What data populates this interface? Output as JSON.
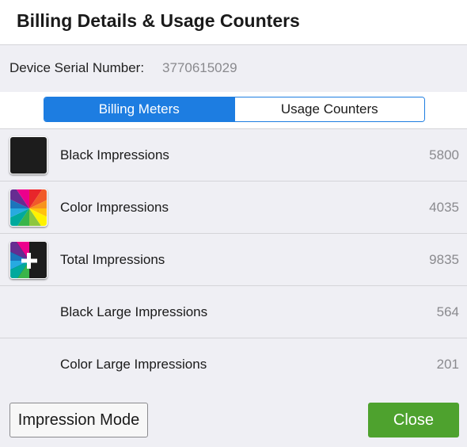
{
  "dialog": {
    "title": "Billing Details & Usage Counters"
  },
  "device": {
    "serial_label": "Device Serial Number:",
    "serial_value": "3770615029"
  },
  "tabs": [
    {
      "label": "Billing Meters",
      "active": true
    },
    {
      "label": "Usage Counters",
      "active": false
    }
  ],
  "meters": [
    {
      "label": "Black Impressions",
      "value": "5800",
      "icon": "black-swatch-icon"
    },
    {
      "label": "Color Impressions",
      "value": "4035",
      "icon": "color-wheel-icon"
    },
    {
      "label": "Total Impressions",
      "value": "9835",
      "icon": "total-plus-icon"
    },
    {
      "label": "Black Large Impressions",
      "value": "564",
      "icon": ""
    },
    {
      "label": "Color Large Impressions",
      "value": "201",
      "icon": ""
    }
  ],
  "footer": {
    "mode_button": "Impression Mode",
    "close_button": "Close"
  },
  "colors": {
    "accent_blue": "#1d7de1",
    "close_green": "#4ea22e",
    "list_background": "#efeff4"
  }
}
